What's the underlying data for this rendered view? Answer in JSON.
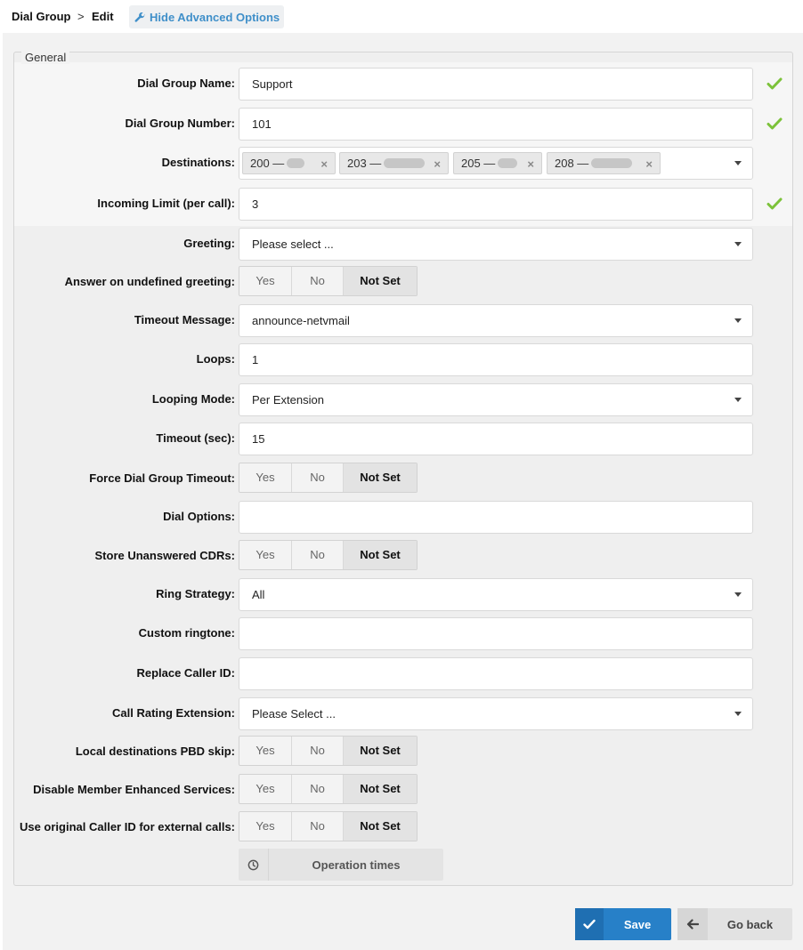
{
  "breadcrumb": {
    "section": "Dial Group",
    "separator": ">",
    "page": "Edit"
  },
  "toolbar": {
    "advanced_label": "Hide Advanced Options",
    "icon": "wrench-icon"
  },
  "fieldset": {
    "legend": "General"
  },
  "fields": {
    "name": {
      "label": "Dial Group Name:",
      "value": "Support"
    },
    "number": {
      "label": "Dial Group Number:",
      "value": "101"
    },
    "destinations": {
      "label": "Destinations:",
      "tags": [
        "200 —",
        "203 —",
        "205 —",
        "208 —"
      ]
    },
    "incoming_limit": {
      "label": "Incoming Limit (per call):",
      "value": "3"
    },
    "greeting": {
      "label": "Greeting:",
      "value": "Please select ..."
    },
    "answer_undefined": {
      "label": "Answer on undefined greeting:"
    },
    "timeout_message": {
      "label": "Timeout Message:",
      "value": "announce-netvmail"
    },
    "loops": {
      "label": "Loops:",
      "value": "1"
    },
    "looping_mode": {
      "label": "Looping Mode:",
      "value": "Per Extension"
    },
    "timeout_sec": {
      "label": "Timeout (sec):",
      "value": "15"
    },
    "force_timeout": {
      "label": "Force Dial Group Timeout:"
    },
    "dial_options": {
      "label": "Dial Options:",
      "value": ""
    },
    "store_unanswered": {
      "label": "Store Unanswered CDRs:"
    },
    "ring_strategy": {
      "label": "Ring Strategy:",
      "value": "All"
    },
    "custom_ringtone": {
      "label": "Custom ringtone:",
      "value": ""
    },
    "replace_callerid": {
      "label": "Replace Caller ID:",
      "value": ""
    },
    "call_rating": {
      "label": "Call Rating Extension:",
      "value": "Please Select ..."
    },
    "local_pbd_skip": {
      "label": "Local destinations PBD skip:"
    },
    "disable_enhanced": {
      "label": "Disable Member Enhanced Services:"
    },
    "use_original_cid": {
      "label": "Use original Caller ID for external calls:"
    }
  },
  "segmented": {
    "yes": "Yes",
    "no": "No",
    "not_set": "Not Set"
  },
  "operation_times": {
    "label": "Operation times"
  },
  "actions": {
    "save": "Save",
    "back": "Go back"
  },
  "colors": {
    "accent": "#2780c8",
    "link": "#3f8fc9",
    "check": "#7cc23a"
  }
}
